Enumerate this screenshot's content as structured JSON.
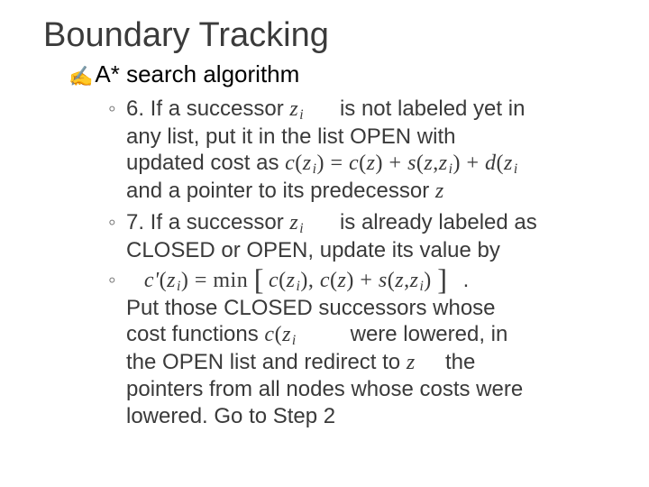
{
  "title": "Boundary Tracking",
  "subhead": {
    "bullet_glyph": "✍",
    "text": "A* search algorithm"
  },
  "items": {
    "six_a": "6.  If a successor",
    "zi_1": "z",
    "zi_1_sub": "i",
    "six_b": "is not labeled yet in",
    "six_line2": "any list, put it in the list OPEN with",
    "six_line3": "updated cost as",
    "cost_eq": {
      "lhs1": "c",
      "lp1": "(",
      "z1": "z",
      "s1": "i",
      "rp1": ")",
      "eq1": " = ",
      "c2": "c",
      "lp2": "(",
      "z2": "z",
      "rp2": ")",
      "plus1": " + ",
      "s": "s",
      "lp3": "(",
      "z3": "z",
      "comma1": ",",
      "z4": "z",
      "s4": "i",
      "rp3": ")",
      "plus2": " + ",
      "d": "d",
      "lp4": "(",
      "z5": "z",
      "s5": "i"
    },
    "six_line4a": "and a pointer to its predecessor",
    "zpred": "z",
    "seven_a": "7.  If a successor",
    "zi_2": "z",
    "zi_2_sub": "i",
    "seven_b": "is already labeled as",
    "seven_line2": "CLOSED or OPEN, update its value by",
    "min_eq": {
      "cprime": "c'",
      "lp1": "(",
      "z1": "z",
      "s1": "i",
      "rp1": ")",
      "eq": " = ",
      "min": "min",
      "lb": "[",
      "c2": "c",
      "lp2": "(",
      "z2": "z",
      "s2": "i",
      "rp2": ")",
      "comma": ",",
      "c3": "c",
      "lp3": "(",
      "z3": "z",
      "rp3": ")",
      "plus": " + ",
      "sfn": "s",
      "lp4": "(",
      "z4": "z",
      "comma2": ",",
      "z5": "z",
      "s5": "i",
      "rp4": ")",
      "rb": "]"
    },
    "dot_tail": ".",
    "closing1": "Put those  CLOSED successors whose",
    "closing2a": "cost functions",
    "czi": "c",
    "czi_lp": "(",
    "czi_z": "z",
    "czi_s": "i",
    "closing2b": "were lowered, in",
    "closing3a": "the OPEN list and redirect to",
    "zredir": "z",
    "closing3b": "the",
    "closing4": "pointers from all nodes whose costs were",
    "closing5": "lowered.  Go to Step 2"
  }
}
